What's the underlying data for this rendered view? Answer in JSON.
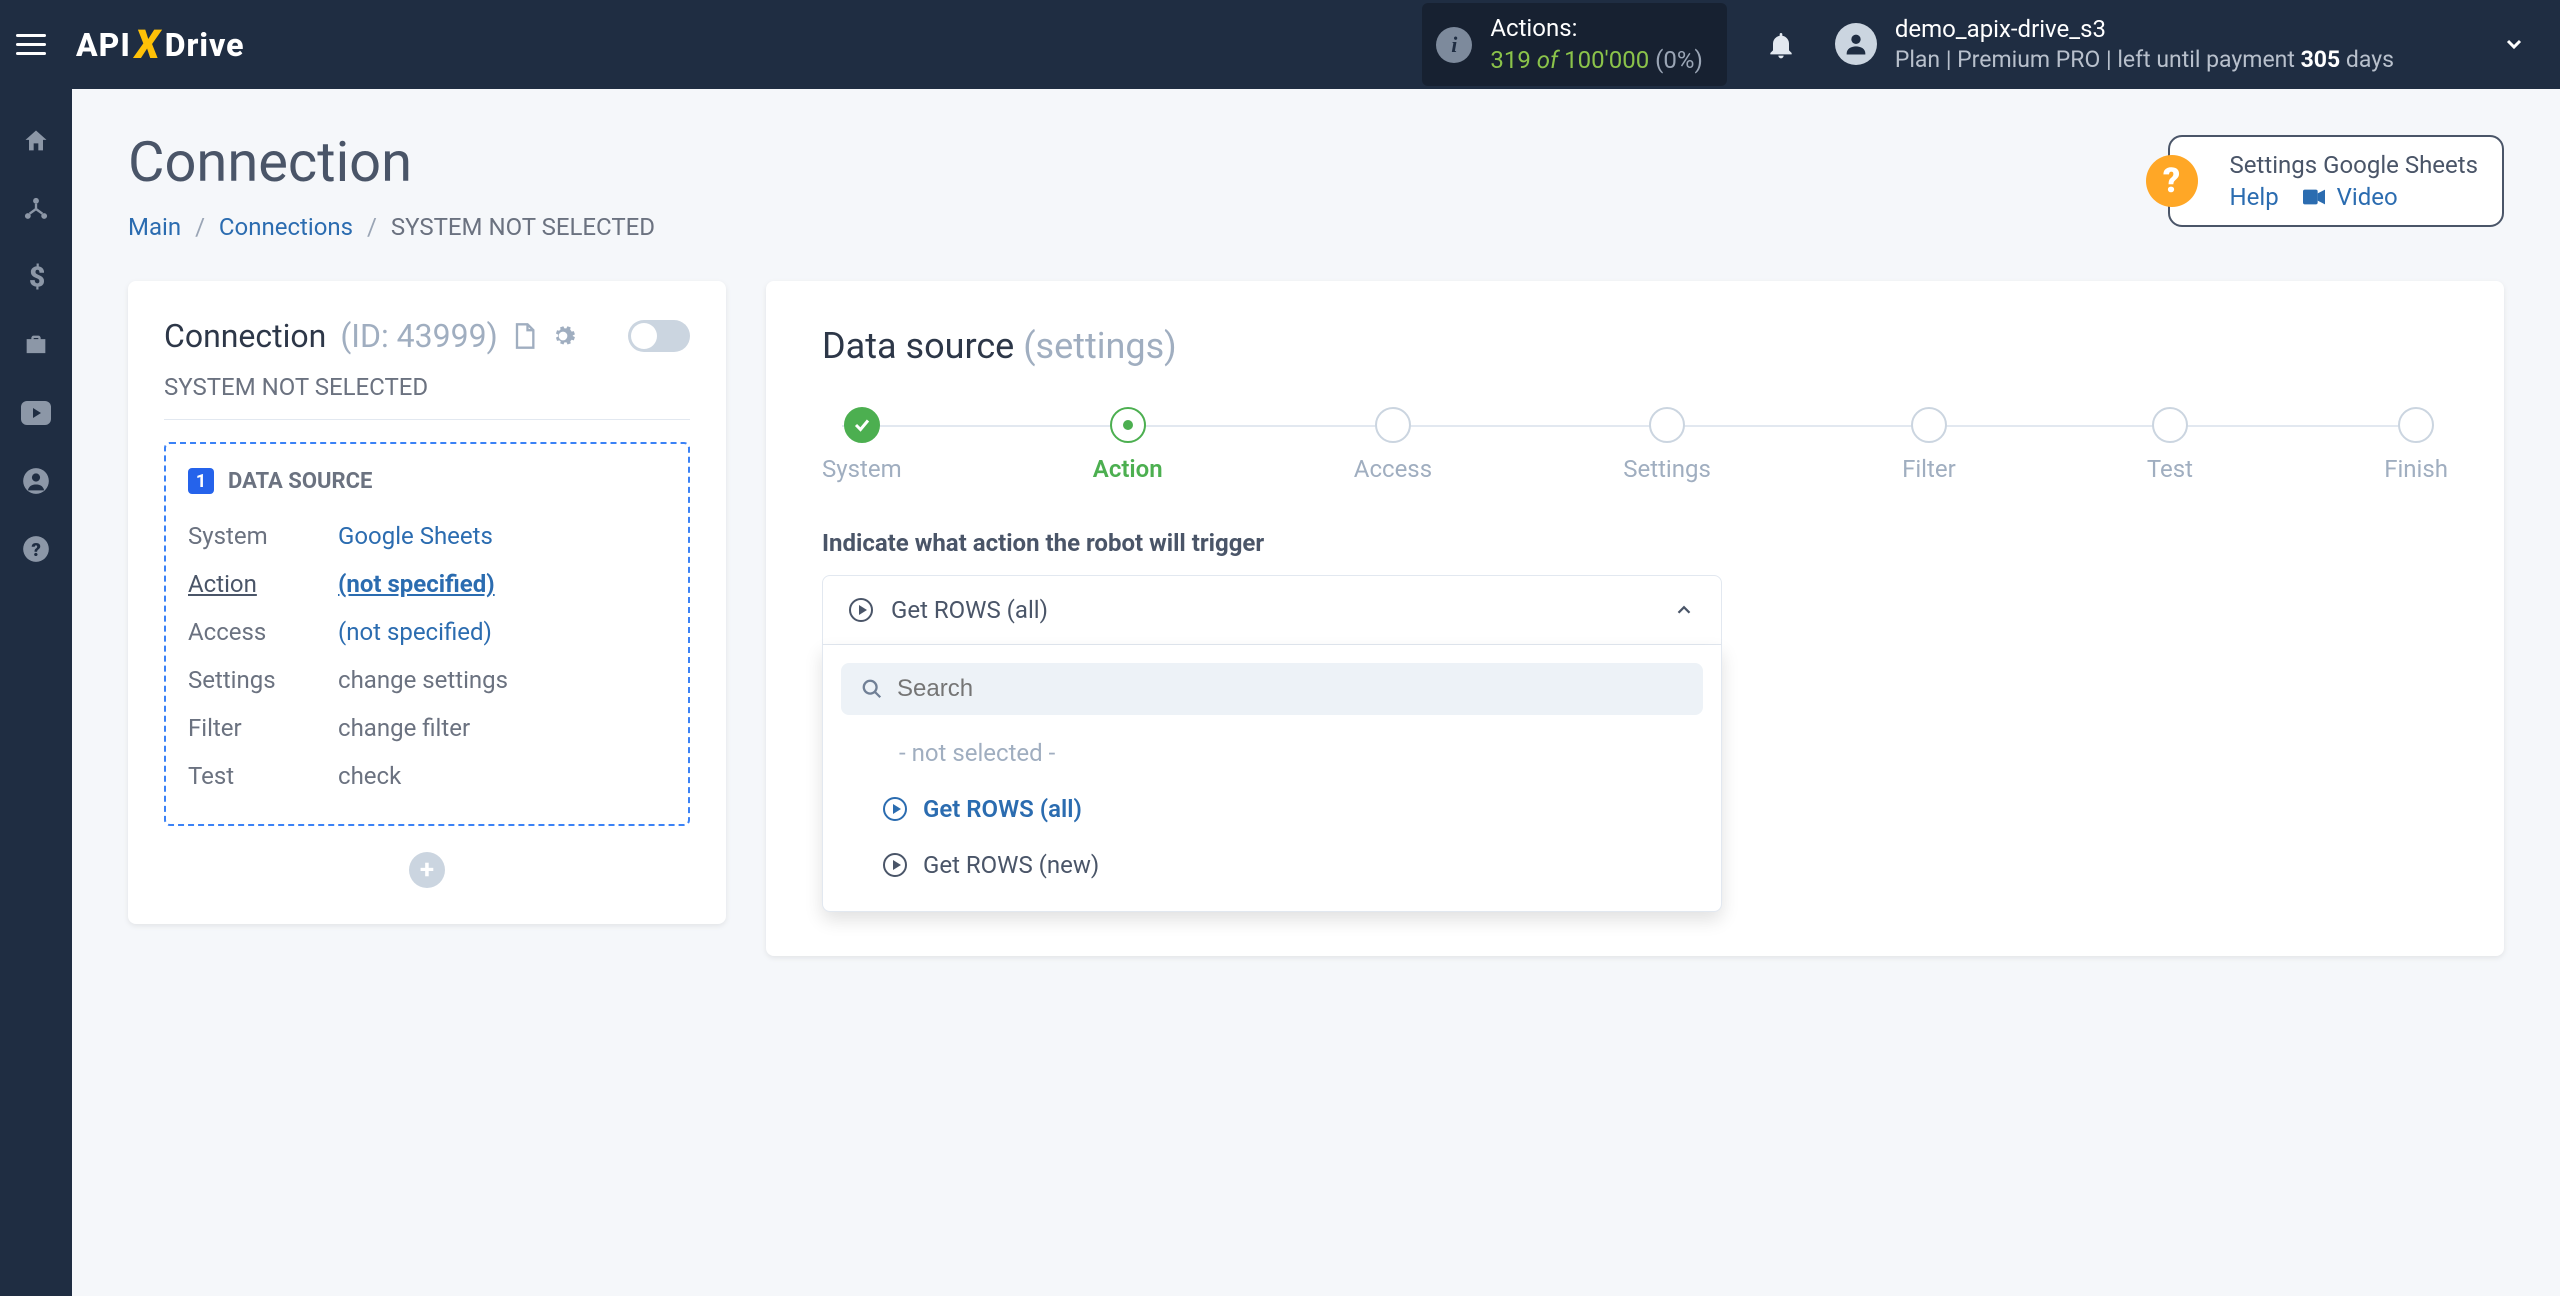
{
  "navbar": {
    "actions_label": "Actions:",
    "actions_count": "319",
    "actions_of": "of",
    "actions_total": "100'000",
    "actions_pct": "(0%)",
    "username": "demo_apix-drive_s3",
    "plan_prefix": "Plan |",
    "plan_name": "Premium PRO",
    "plan_left": "| left until payment",
    "days_count": "305",
    "days_word": "days"
  },
  "page": {
    "title": "Connection",
    "breadcrumb": {
      "main": "Main",
      "connections": "Connections",
      "current": "SYSTEM NOT SELECTED"
    }
  },
  "help": {
    "title": "Settings Google Sheets",
    "help": "Help",
    "video": "Video"
  },
  "left": {
    "conn_label": "Connection",
    "id_label": "(ID: 43999)",
    "subtitle": "SYSTEM NOT SELECTED",
    "ds_label": "DATA SOURCE",
    "rows": {
      "system_k": "System",
      "system_v": "Google Sheets",
      "action_k": "Action",
      "action_v": "(not specified)",
      "access_k": "Access",
      "access_v": "(not specified)",
      "settings_k": "Settings",
      "settings_v": "change settings",
      "filter_k": "Filter",
      "filter_v": "change filter",
      "test_k": "Test",
      "test_v": "check"
    }
  },
  "right": {
    "title_main": "Data source",
    "title_sub": "(settings)",
    "steps": [
      "System",
      "Action",
      "Access",
      "Settings",
      "Filter",
      "Test",
      "Finish"
    ],
    "field_label": "Indicate what action the robot will trigger",
    "selected": "Get ROWS (all)",
    "search_placeholder": "Search",
    "opt_not_selected": "- not selected -",
    "opt1": "Get ROWS (all)",
    "opt2": "Get ROWS (new)"
  }
}
